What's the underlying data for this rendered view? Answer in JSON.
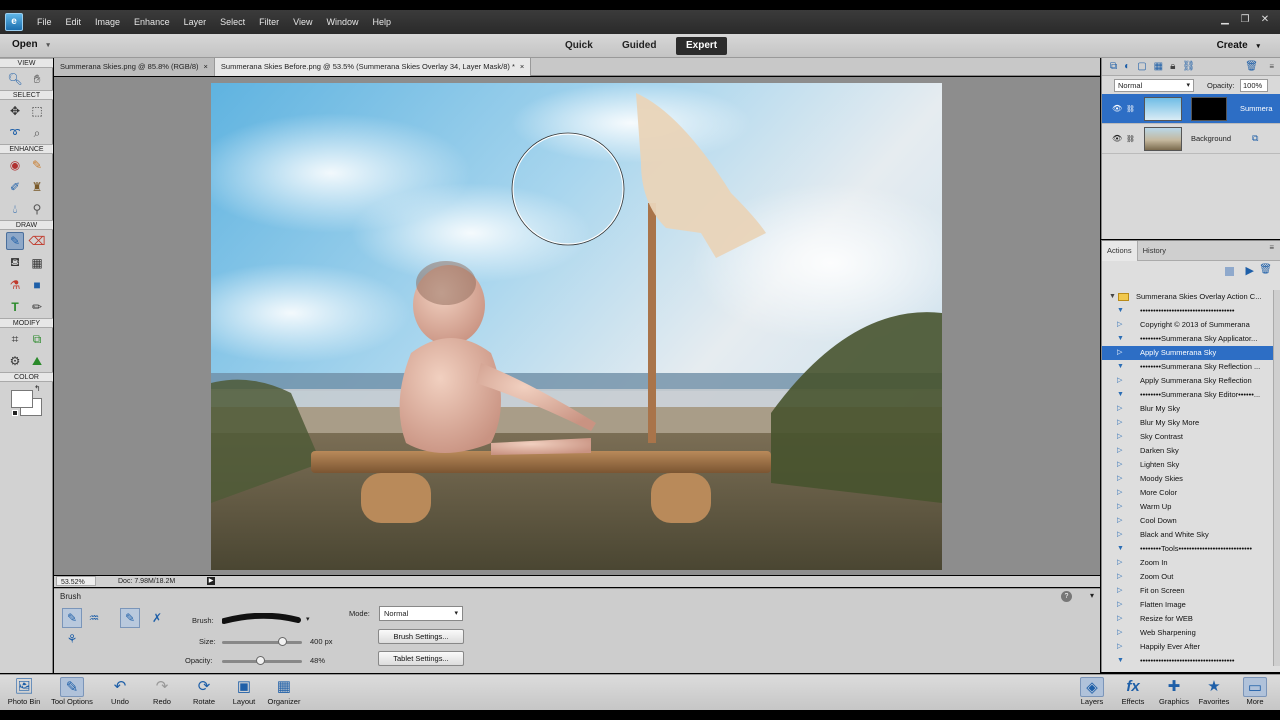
{
  "menubar": {
    "items": [
      "File",
      "Edit",
      "Image",
      "Enhance",
      "Layer",
      "Select",
      "Filter",
      "View",
      "Window",
      "Help"
    ]
  },
  "modebar": {
    "open": "Open",
    "tabs": [
      "Quick",
      "Guided",
      "Expert"
    ],
    "create": "Create"
  },
  "toolbox": {
    "sections": [
      "VIEW",
      "SELECT",
      "ENHANCE",
      "DRAW",
      "MODIFY",
      "COLOR"
    ]
  },
  "doctabs": [
    {
      "label": "Summerana Skies.png @ 85.8% (RGB/8)"
    },
    {
      "label": "Summerana Skies Before.png @ 53.5% (Summerana Skies Overlay 34, Layer Mask/8) *"
    }
  ],
  "status": {
    "zoom": "53.52%",
    "doc": "Doc: 7.98M/18.2M"
  },
  "tooloptions": {
    "title": "Brush",
    "brush_label": "Brush:",
    "size_label": "Size:",
    "size_value": "400 px",
    "size_fraction": 0.75,
    "opacity_label": "Opacity:",
    "opacity_value": "48%",
    "opacity_fraction": 0.48,
    "mode_label": "Mode:",
    "mode_value": "Normal",
    "brush_settings": "Brush Settings...",
    "tablet_settings": "Tablet Settings..."
  },
  "taskbar": {
    "left": [
      "Photo Bin",
      "Tool Options",
      "Undo",
      "Redo",
      "Rotate",
      "Layout",
      "Organizer"
    ],
    "right": [
      "Layers",
      "Effects",
      "Graphics",
      "Favorites",
      "More"
    ]
  },
  "layers": {
    "blend_mode": "Normal",
    "opacity_label": "Opacity:",
    "opacity_value": "100%",
    "rows": [
      {
        "name": "Summera"
      },
      {
        "name": "Background"
      }
    ]
  },
  "actions": {
    "tabs": [
      "Actions",
      "History"
    ],
    "items": [
      {
        "label": "Summerana Skies Overlay Action C...",
        "kind": "folder"
      },
      {
        "label": "••••••••••••••••••••••••••••••••••••",
        "kind": "open"
      },
      {
        "label": "Copyright © 2013 of Summerana",
        "kind": "closed"
      },
      {
        "label": "••••••••Summerana Sky Applicator...",
        "kind": "open"
      },
      {
        "label": "Apply Summerana Sky",
        "kind": "selected"
      },
      {
        "label": "••••••••Summerana Sky Reflection ...",
        "kind": "open"
      },
      {
        "label": "Apply Summerana Sky Reflection",
        "kind": "closed"
      },
      {
        "label": "••••••••Summerana Sky Editor••••••...",
        "kind": "open"
      },
      {
        "label": "Blur My Sky",
        "kind": "closed"
      },
      {
        "label": "Blur My Sky More",
        "kind": "closed"
      },
      {
        "label": "Sky Contrast",
        "kind": "closed"
      },
      {
        "label": "Darken Sky",
        "kind": "closed"
      },
      {
        "label": "Lighten Sky",
        "kind": "closed"
      },
      {
        "label": "Moody Skies",
        "kind": "closed"
      },
      {
        "label": "More Color",
        "kind": "closed"
      },
      {
        "label": "Warm Up",
        "kind": "closed"
      },
      {
        "label": "Cool Down",
        "kind": "closed"
      },
      {
        "label": "Black and White Sky",
        "kind": "closed"
      },
      {
        "label": "••••••••Tools••••••••••••••••••••••••••••",
        "kind": "open"
      },
      {
        "label": "Zoom In",
        "kind": "closed"
      },
      {
        "label": "Zoom Out",
        "kind": "closed"
      },
      {
        "label": "Fit on Screen",
        "kind": "closed"
      },
      {
        "label": "Flatten Image",
        "kind": "closed"
      },
      {
        "label": "Resize for WEB",
        "kind": "closed"
      },
      {
        "label": "Web Sharpening",
        "kind": "closed"
      },
      {
        "label": "Happily Ever After",
        "kind": "closed"
      },
      {
        "label": "••••••••••••••••••••••••••••••••••••",
        "kind": "open"
      }
    ]
  },
  "colors": {
    "accent": "#2d6ec5",
    "icon": "#1e5fa8"
  }
}
